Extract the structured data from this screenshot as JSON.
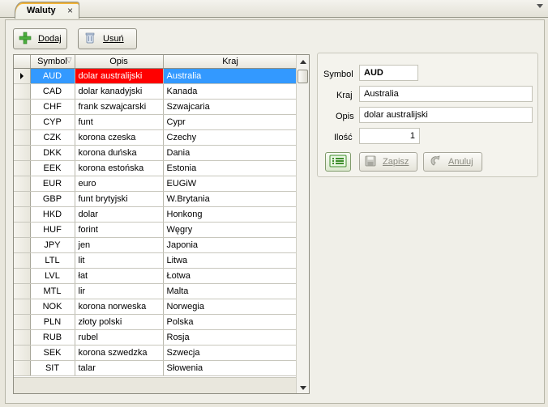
{
  "tab": {
    "title": "Waluty",
    "close_glyph": "×"
  },
  "toolbar": {
    "add_label": "Dodaj",
    "delete_label": "Usuń"
  },
  "grid": {
    "columns": [
      "Symbol",
      "Opis",
      "Kraj"
    ],
    "rows": [
      {
        "symbol": "AUD",
        "opis": "dolar australijski",
        "kraj": "Australia",
        "selected": true
      },
      {
        "symbol": "CAD",
        "opis": "dolar kanadyjski",
        "kraj": "Kanada"
      },
      {
        "symbol": "CHF",
        "opis": "frank szwajcarski",
        "kraj": "Szwajcaria"
      },
      {
        "symbol": "CYP",
        "opis": "funt",
        "kraj": "Cypr"
      },
      {
        "symbol": "CZK",
        "opis": "korona czeska",
        "kraj": "Czechy"
      },
      {
        "symbol": "DKK",
        "opis": "korona duńska",
        "kraj": "Dania"
      },
      {
        "symbol": "EEK",
        "opis": "korona estońska",
        "kraj": "Estonia"
      },
      {
        "symbol": "EUR",
        "opis": "euro",
        "kraj": "EUGiW"
      },
      {
        "symbol": "GBP",
        "opis": "funt brytyjski",
        "kraj": "W.Brytania"
      },
      {
        "symbol": "HKD",
        "opis": "dolar",
        "kraj": "Honkong"
      },
      {
        "symbol": "HUF",
        "opis": "forint",
        "kraj": "Węgry"
      },
      {
        "symbol": "JPY",
        "opis": "jen",
        "kraj": "Japonia"
      },
      {
        "symbol": "LTL",
        "opis": "lit",
        "kraj": "Litwa"
      },
      {
        "symbol": "LVL",
        "opis": "łat",
        "kraj": "Łotwa"
      },
      {
        "symbol": "MTL",
        "opis": "lir",
        "kraj": "Malta"
      },
      {
        "symbol": "NOK",
        "opis": "korona norweska",
        "kraj": "Norwegia"
      },
      {
        "symbol": "PLN",
        "opis": "złoty polski",
        "kraj": "Polska"
      },
      {
        "symbol": "RUB",
        "opis": "rubel",
        "kraj": "Rosja"
      },
      {
        "symbol": "SEK",
        "opis": "korona szwedzka",
        "kraj": "Szwecja"
      },
      {
        "symbol": "SIT",
        "opis": "talar",
        "kraj": "Słowenia"
      }
    ]
  },
  "detail": {
    "symbol_label": "Symbol",
    "symbol_value": "AUD",
    "kraj_label": "Kraj",
    "kraj_value": "Australia",
    "opis_label": "Opis",
    "opis_value": "dolar australijski",
    "ilosc_label": "Ilość",
    "ilosc_value": "1",
    "save_label": "Zapisz",
    "cancel_label": "Anuluj"
  },
  "colors": {
    "selection_blue": "#3399ff",
    "selection_focus_red": "#ff0000",
    "tab_accent": "#f2b43a"
  },
  "icons": [
    "close-icon",
    "menu-dropdown-icon",
    "add-icon",
    "delete-icon",
    "sort-icon",
    "row-indicator-icon",
    "list-view-icon",
    "save-icon",
    "cancel-icon"
  ]
}
